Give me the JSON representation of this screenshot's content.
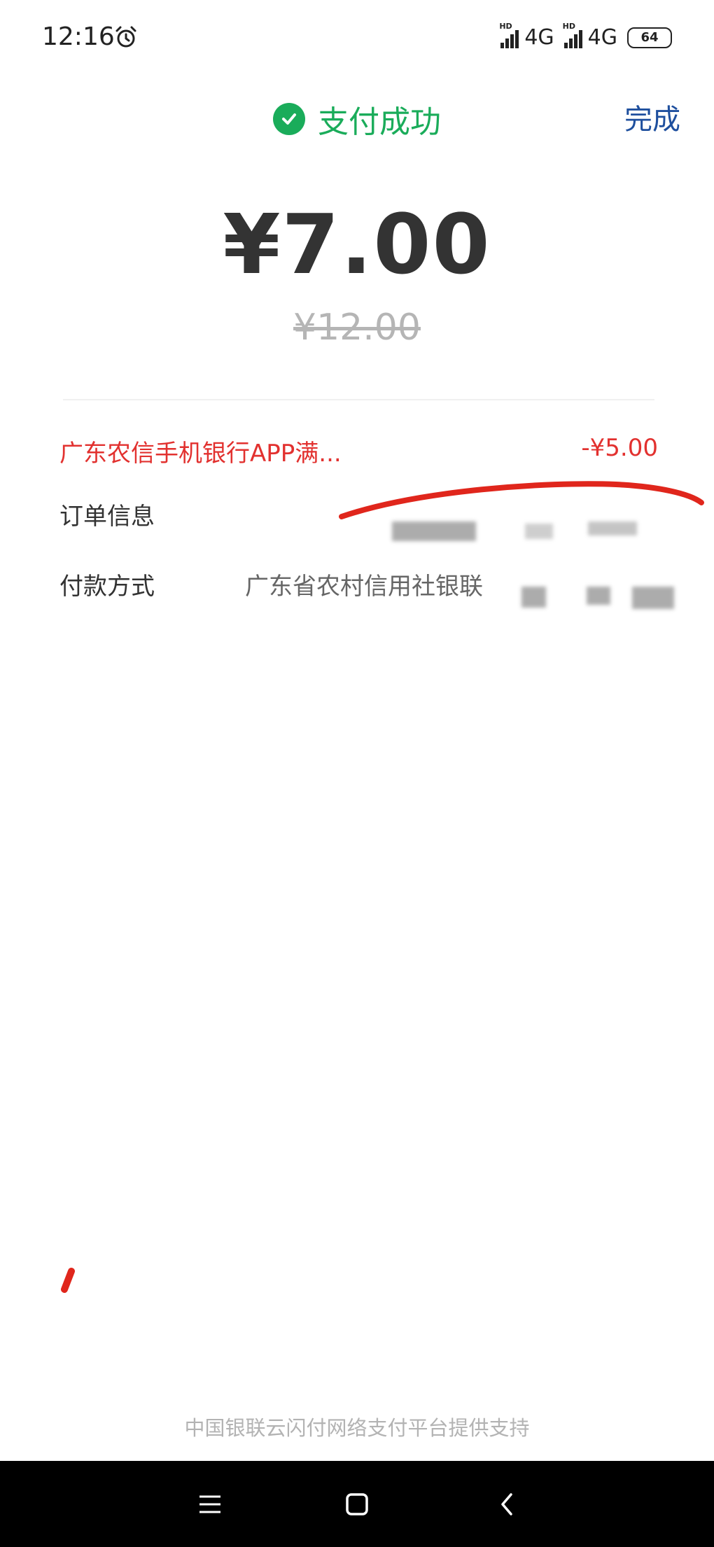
{
  "status_bar": {
    "time": "12:16",
    "alarm_icon": "alarm-clock-icon",
    "network_1": "4G",
    "network_2": "4G",
    "hd_label": "HD",
    "battery": "64"
  },
  "header": {
    "status_icon": "check-circle-icon",
    "title": "支付成功",
    "done_label": "完成"
  },
  "payment": {
    "amount": "¥7.00",
    "original_amount": "¥12.00"
  },
  "discount": {
    "label": "广东农信手机银行APP满...",
    "value": "-¥5.00"
  },
  "order": {
    "label": "订单信息"
  },
  "pay_method": {
    "label": "付款方式",
    "value": "广东省农村信用社银联"
  },
  "footer": {
    "note": "中国银联云闪付网络支付平台提供支持"
  },
  "colors": {
    "success": "#1aac5a",
    "link": "#1e4f9e",
    "discount": "#e2312f",
    "annotation": "#e0261c"
  }
}
